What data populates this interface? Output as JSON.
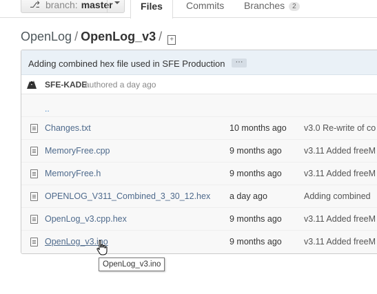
{
  "branch": {
    "label": "branch:",
    "name": "master"
  },
  "tabs": [
    {
      "label": "Files"
    },
    {
      "label": "Commits"
    },
    {
      "label": "Branches",
      "count": "2"
    }
  ],
  "breadcrumb": {
    "repo": "OpenLog",
    "separator": "/",
    "current": "OpenLog_v3",
    "trailing_separator": "/"
  },
  "latest_commit": {
    "message": "Adding combined hex file used in SFE Production",
    "expand_label": "···",
    "author": "SFE-KADE",
    "authored": "authored a day ago"
  },
  "updir": "..",
  "files": [
    {
      "name": "Changes.txt",
      "age": "10 months ago",
      "message": "v3.0 Re-write of co"
    },
    {
      "name": "MemoryFree.cpp",
      "age": "9 months ago",
      "message": "v3.11 Added freeM"
    },
    {
      "name": "MemoryFree.h",
      "age": "9 months ago",
      "message": "v3.11 Added freeM"
    },
    {
      "name": "OPENLOG_V311_Combined_3_30_12.hex",
      "age": "a day ago",
      "message": "Adding combined"
    },
    {
      "name": "OpenLog_v3.cpp.hex",
      "age": "9 months ago",
      "message": "v3.11 Added freeM"
    },
    {
      "name": "OpenLog_v3.ino",
      "age": "9 months ago",
      "message": "v3.11 Added freeM"
    }
  ],
  "tooltip": "OpenLog_v3.ino",
  "colors": {
    "link": "#4e6a8c",
    "commit_bar": "#eaf1f7",
    "row_bg": "#f8f8f8"
  }
}
